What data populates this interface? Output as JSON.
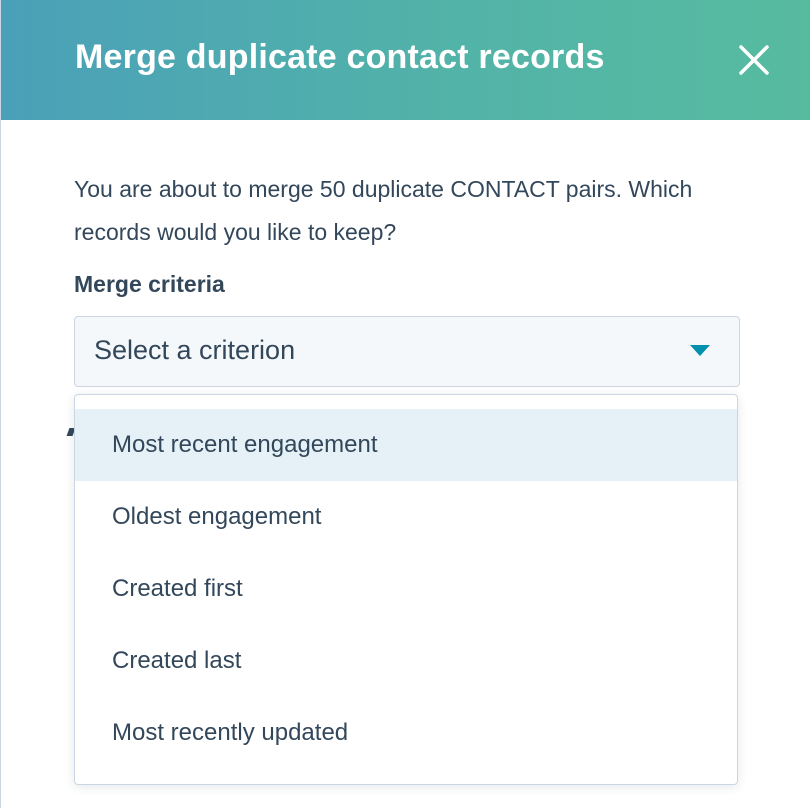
{
  "dialog": {
    "title": "Merge duplicate contact records",
    "close_icon": "close-icon",
    "header_gradient": [
      "#4aa0b8",
      "#57bba0"
    ]
  },
  "intro": {
    "text": "You are about to merge 50 duplicate CONTACT pairs. Which records would you like to keep?"
  },
  "merge_criteria": {
    "label": "Merge criteria",
    "select_value": "Select a criterion",
    "caret_icon": "caret-down-icon",
    "options": [
      {
        "label": "Most recent engagement",
        "highlighted": true
      },
      {
        "label": "Oldest engagement",
        "highlighted": false
      },
      {
        "label": "Created first",
        "highlighted": false
      },
      {
        "label": "Created last",
        "highlighted": false
      },
      {
        "label": "Most recently updated",
        "highlighted": false
      }
    ]
  },
  "colors": {
    "text": "#33475b",
    "accent": "#0091ae",
    "highlight": "#e5f1f7",
    "border": "#cbd6e2"
  }
}
